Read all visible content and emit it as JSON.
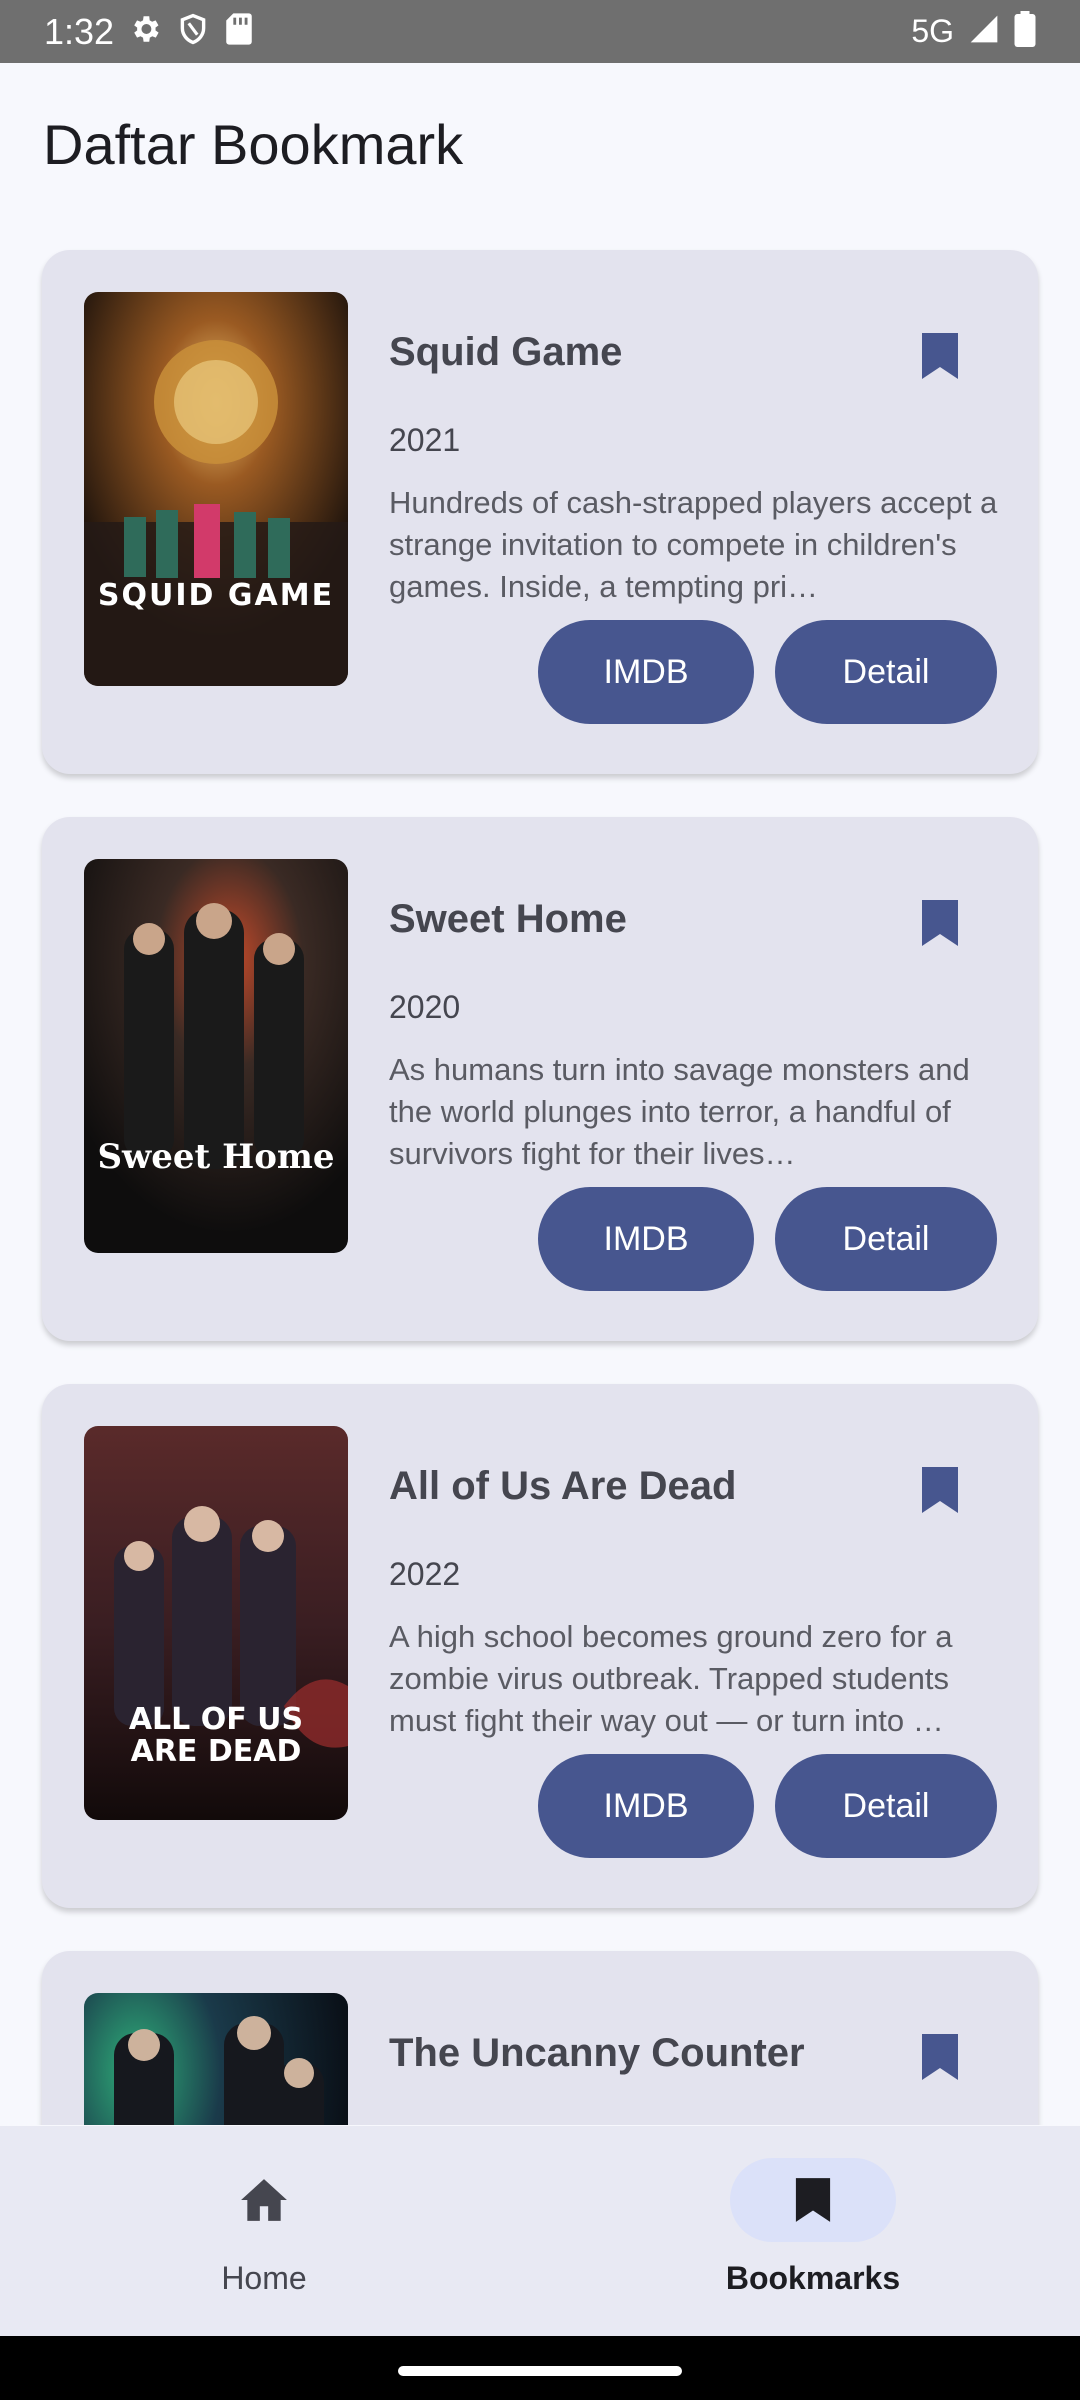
{
  "status_bar": {
    "time": "1:32",
    "network": "5G",
    "icons": [
      "settings-icon",
      "shield-icon",
      "sim-card-icon",
      "signal-icon",
      "battery-icon"
    ]
  },
  "page": {
    "title": "Daftar Bookmark"
  },
  "bookmarks": [
    {
      "title": "Squid Game",
      "year": "2021",
      "overview": "Hundreds of cash-strapped players accept a strange invitation to compete in children's games. Inside, a tempting pri…",
      "poster_text": "SQUID GAME",
      "imdb_label": "IMDB",
      "detail_label": "Detail"
    },
    {
      "title": "Sweet Home",
      "year": "2020",
      "overview": "As humans turn into savage monsters and the world plunges into terror, a handful of survivors fight for their lives…",
      "poster_text": "Sweet Home",
      "imdb_label": "IMDB",
      "detail_label": "Detail"
    },
    {
      "title": "All of Us Are Dead",
      "year": "2022",
      "overview": "A high school becomes ground zero for a zombie virus outbreak. Trapped students must fight their way out — or turn into …",
      "poster_text": "ALL OF US ARE DEAD",
      "imdb_label": "IMDB",
      "detail_label": "Detail"
    },
    {
      "title": "The Uncanny Counter",
      "year": "",
      "overview": "",
      "poster_text": "",
      "imdb_label": "",
      "detail_label": ""
    }
  ],
  "bottom_nav": {
    "items": [
      {
        "label": "Home",
        "icon": "home-icon",
        "active": false
      },
      {
        "label": "Bookmarks",
        "icon": "bookmark-icon",
        "active": true
      }
    ]
  },
  "colors": {
    "accent": "#47568f",
    "card_bg": "#e3e3ee",
    "page_bg": "#f7f8fd",
    "nav_active_pill": "#dbe1f9"
  }
}
